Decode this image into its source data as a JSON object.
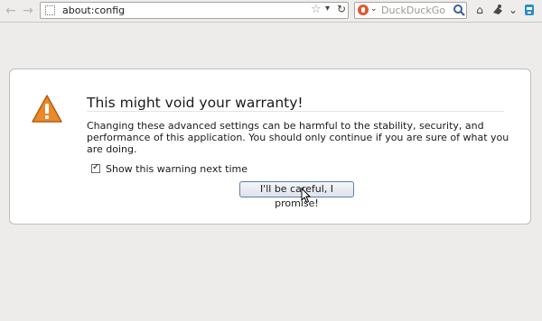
{
  "toolbar": {
    "url": "about:config",
    "search_placeholder": "DuckDuckGo",
    "icons": {
      "back": "back-arrow-icon",
      "forward": "forward-arrow-icon",
      "back_glyph": "←",
      "forward_glyph": "→",
      "bookmark_star": "☆",
      "dropdown": "▾",
      "reload": "↻",
      "search_dropdown": "⌄",
      "home": "⌂",
      "menu": "⌄"
    }
  },
  "warning": {
    "title": "This might void your warranty!",
    "body": "Changing these advanced settings can be harmful to the stability, security, and performance of this application. You should only continue if you are sure of what you are doing.",
    "checkbox_label": "Show this warning next time",
    "checkbox_checked": true,
    "button_label": "I'll be careful, I promise!"
  },
  "colors": {
    "alert_triangle": "#e8892b",
    "ddg_orange": "#de5833",
    "button_border": "#5e7fa6"
  }
}
